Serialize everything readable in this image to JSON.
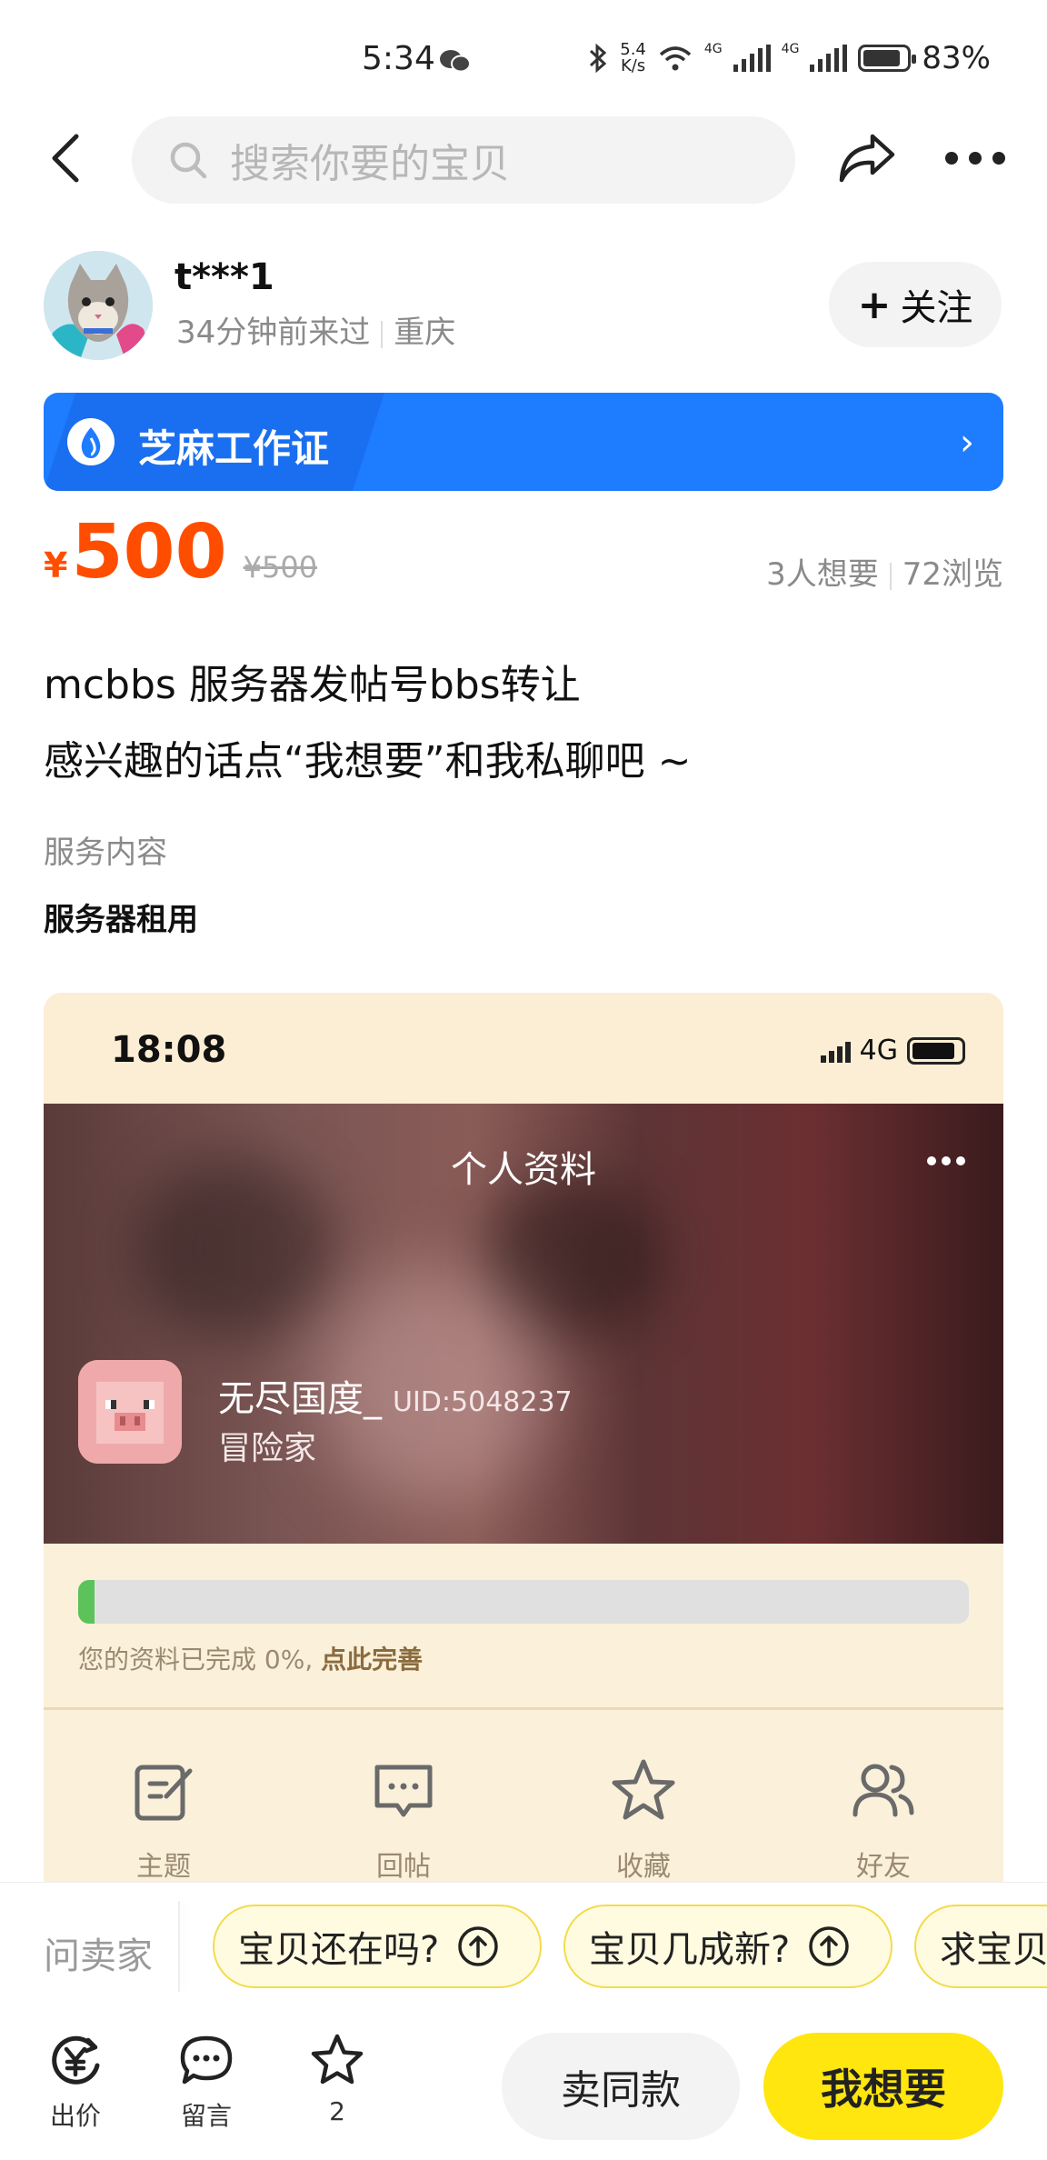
{
  "status_bar": {
    "time": "5:34",
    "net_speed_top": "5.4",
    "net_speed_bottom": "K/s",
    "sig1_label": "4G",
    "sig2_label": "4G",
    "battery": "83%",
    "battery_level": 0.83
  },
  "nav": {
    "search_placeholder": "搜索你要的宝贝"
  },
  "seller": {
    "name": "t***1",
    "last_seen": "34分钟前来过",
    "location": "重庆",
    "follow_label": "关注",
    "follow_plus": "+"
  },
  "zhima": {
    "label": "芝麻工作证",
    "chevron": "›",
    "color": "#1e7cff"
  },
  "price": {
    "currency": "¥",
    "value": "500",
    "original": "¥500",
    "color": "#ff4d00"
  },
  "stats": {
    "wants": "3人想要",
    "views": "72浏览"
  },
  "description": {
    "line1": "mcbbs 服务器发帖号bbs转让",
    "line2": "感兴趣的话点“我想要”和我私聊吧 ~"
  },
  "service": {
    "label": "服务内容",
    "value": "服务器租用"
  },
  "embedded_screenshot": {
    "time": "18:08",
    "network": "4G",
    "page_title": "个人资料",
    "username": "无尽国度_",
    "uid": "UID:5048237",
    "role": "冒险家",
    "profile_progress": 0.0,
    "progress_text": "您的资料已完成 0%,",
    "progress_link": "点此完善",
    "tabs": [
      {
        "label": "主题",
        "icon": "edit-icon"
      },
      {
        "label": "回帖",
        "icon": "comment-icon"
      },
      {
        "label": "收藏",
        "icon": "star-icon"
      },
      {
        "label": "好友",
        "icon": "friends-icon"
      }
    ]
  },
  "quick_questions": {
    "ask_label": "问卖家",
    "chips": [
      "宝贝还在吗?",
      "宝贝几成新?",
      "求宝贝"
    ]
  },
  "bottom_bar": {
    "offer_label": "出价",
    "comment_label": "留言",
    "favorite_count": "2",
    "same_label": "卖同款",
    "want_label": "我想要",
    "want_color": "#ffe60f"
  }
}
